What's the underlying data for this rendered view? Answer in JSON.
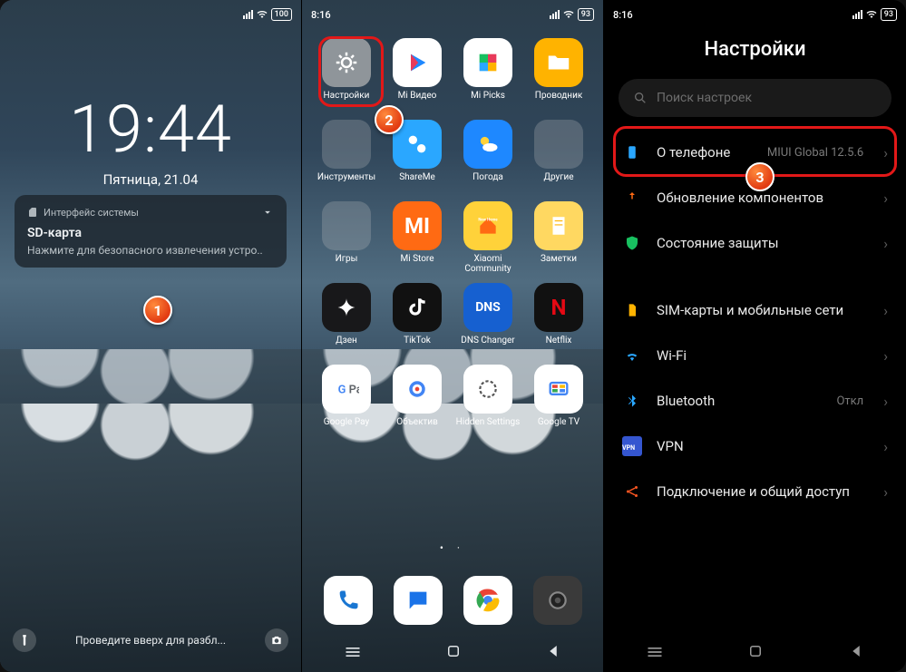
{
  "pane1": {
    "status": {
      "time": "",
      "battery": "100"
    },
    "clock": {
      "time": "19:44",
      "date": "Пятница, 21.04"
    },
    "notif": {
      "source": "Интерфейс системы",
      "title": "SD-карта",
      "message": "Нажмите для безопасного извлечения устро.."
    },
    "lockbar": {
      "hint": "Проведите вверх для разбл..."
    },
    "badge": "1"
  },
  "pane2": {
    "status": {
      "time": "8:16",
      "battery": "93"
    },
    "apps": [
      {
        "label": "Настройки",
        "bg": "#8f959a",
        "glyph": "gear"
      },
      {
        "label": "Mi Видео",
        "bg": "#ffffff",
        "glyph": "play"
      },
      {
        "label": "Mi Picks",
        "bg": "#ffffff",
        "glyph": "picks"
      },
      {
        "label": "Проводник",
        "bg": "#ffb300",
        "glyph": "folder"
      },
      {
        "label": "Инструменты",
        "folder": true
      },
      {
        "label": "ShareMe",
        "bg": "#2aa7ff",
        "glyph": "share"
      },
      {
        "label": "Погода",
        "bg": "#1e88ff",
        "glyph": "weather"
      },
      {
        "label": "Другие",
        "folder": true
      },
      {
        "label": "Игры",
        "folder": true
      },
      {
        "label": "Mi Store",
        "bg": "#ff6a13",
        "txt": "MI"
      },
      {
        "label": "Xiaomi Community",
        "bg": "#ffd23a",
        "glyph": "home"
      },
      {
        "label": "Заметки",
        "bg": "#ffd861",
        "glyph": "note"
      },
      {
        "label": "Дзен",
        "bg": "#18181a",
        "glyph": "dzen"
      },
      {
        "label": "TikTok",
        "bg": "#111",
        "glyph": "tiktok"
      },
      {
        "label": "DNS Changer",
        "bg": "#1660d0",
        "txt": "DNS"
      },
      {
        "label": "Netflix",
        "bg": "#111",
        "txt": "N",
        "txtColor": "#e50914"
      },
      {
        "label": "Google Pay",
        "bg": "#fff",
        "glyph": "gpay"
      },
      {
        "label": "Объектив",
        "bg": "#fff",
        "glyph": "lens"
      },
      {
        "label": "Hidden Settings",
        "bg": "#fff",
        "glyph": "hgear"
      },
      {
        "label": "Google TV",
        "bg": "#fff",
        "glyph": "gtv"
      }
    ],
    "dock": [
      {
        "name": "phone",
        "bg": "#fff"
      },
      {
        "name": "messages",
        "bg": "#fff"
      },
      {
        "name": "chrome",
        "bg": "#fff"
      },
      {
        "name": "camera",
        "bg": "#3a3a3a"
      }
    ],
    "badge": "2"
  },
  "pane3": {
    "status": {
      "time": "8:16",
      "battery": "93"
    },
    "title": "Настройки",
    "search_placeholder": "Поиск настроек",
    "items": [
      {
        "icon": "phone-info",
        "color": "#2aa7ff",
        "label": "О телефоне",
        "value": "MIUI Global 12.5.6",
        "highlighted": true
      },
      {
        "icon": "update",
        "color": "#ff6a13",
        "label": "Обновление компонентов"
      },
      {
        "icon": "shield",
        "color": "#18c060",
        "label": "Состояние защиты"
      },
      {
        "gap": true
      },
      {
        "icon": "sim",
        "color": "#ffb300",
        "label": "SIM-карты и мобильные сети"
      },
      {
        "icon": "wifi",
        "color": "#2aa7ff",
        "label": "Wi-Fi",
        "value": " "
      },
      {
        "icon": "bt",
        "color": "#2aa7ff",
        "label": "Bluetooth",
        "value": "Откл"
      },
      {
        "icon": "vpn",
        "color": "#3556d0",
        "label": "VPN"
      },
      {
        "icon": "share",
        "color": "#ff5722",
        "label": "Подключение и общий доступ"
      }
    ],
    "badge": "3"
  }
}
